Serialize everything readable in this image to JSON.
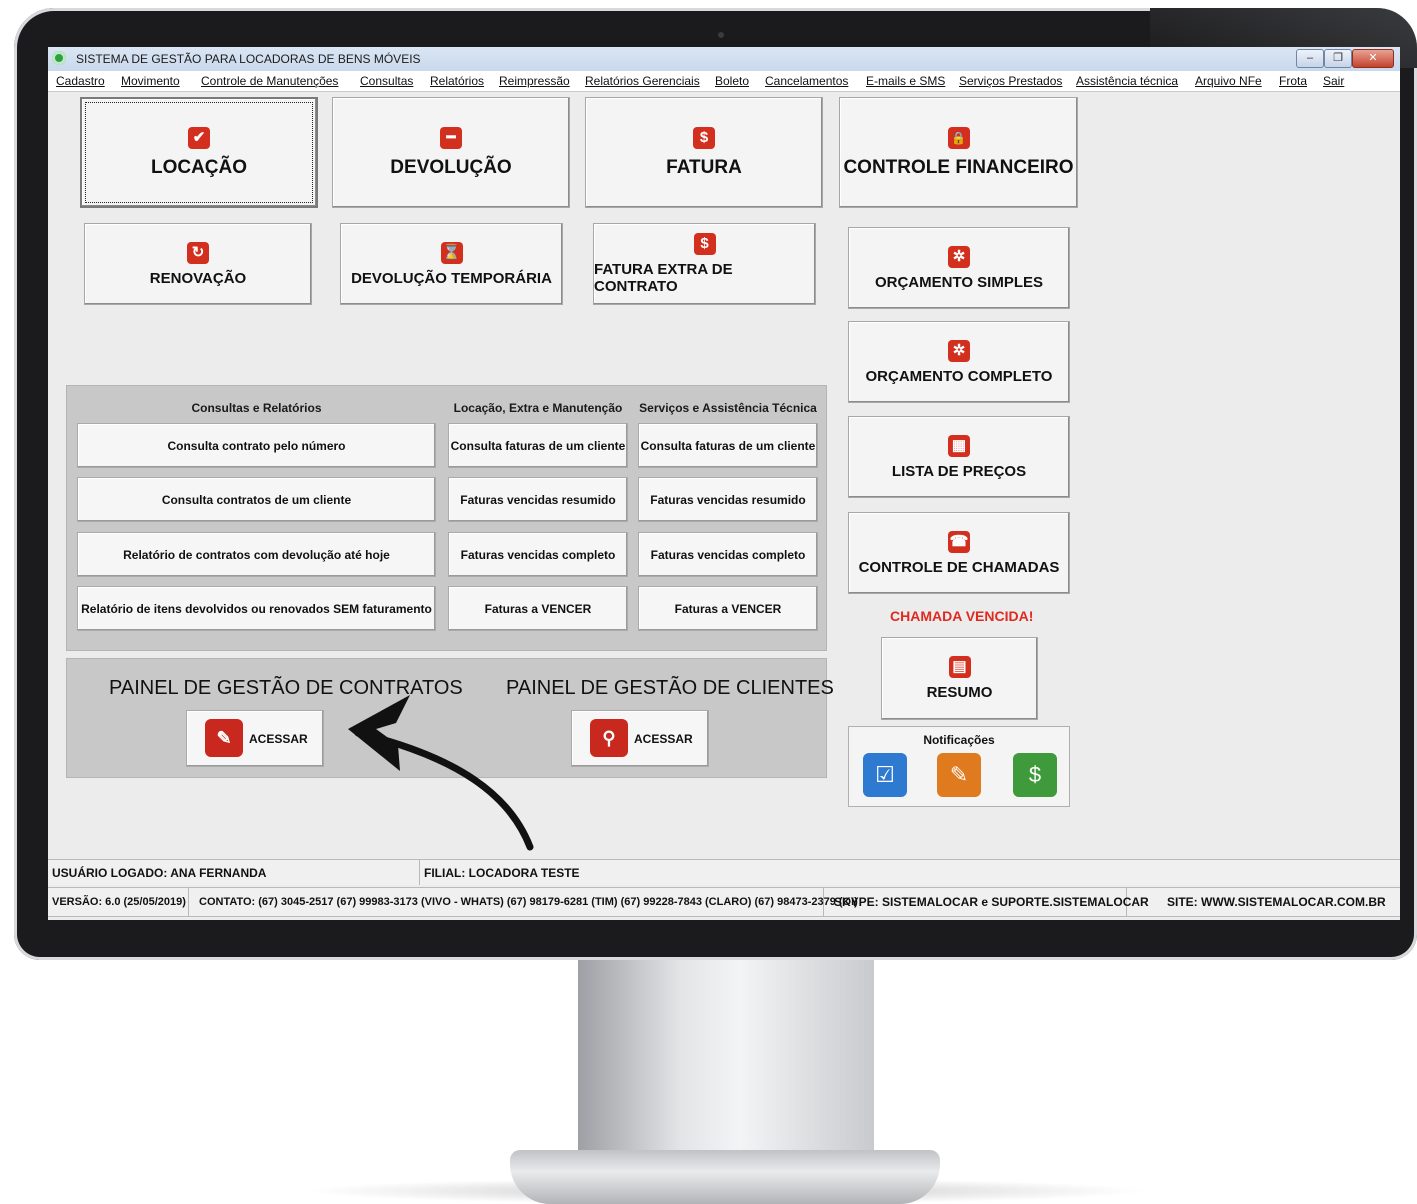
{
  "window": {
    "title": "SISTEMA DE GESTÃO PARA LOCADORAS DE BENS MÓVEIS",
    "minimize_glyph": "–",
    "restore_glyph": "❐",
    "close_glyph": "✕"
  },
  "menu": [
    "Cadastro",
    "Movimento",
    "Controle de Manutenções",
    "Consultas",
    "Relatórios",
    "Reimpressão",
    "Relatórios Gerenciais",
    "Boleto",
    "Cancelamentos",
    "E-mails e SMS",
    "Serviços Prestados",
    "Assistência técnica",
    "Arquivo NFe",
    "Frota",
    "Sair"
  ],
  "main_buttons": {
    "locacao": {
      "label": "LOCAÇÃO",
      "icon": "check-icon",
      "glyph": "✔"
    },
    "devolucao": {
      "label": "DEVOLUÇÃO",
      "icon": "minus-icon",
      "glyph": "━"
    },
    "fatura": {
      "label": "FATURA",
      "icon": "dollar-icon",
      "glyph": "$"
    },
    "controle_financeiro": {
      "label": "CONTROLE FINANCEIRO",
      "icon": "lock-icon",
      "glyph": "🔒"
    },
    "renovacao": {
      "label": "RENOVAÇÃO",
      "icon": "refresh-icon",
      "glyph": "↻"
    },
    "devolucao_temporaria": {
      "label": "DEVOLUÇÃO TEMPORÁRIA",
      "icon": "hourglass-icon",
      "glyph": "⌛"
    },
    "fatura_extra": {
      "label": "FATURA EXTRA DE CONTRATO",
      "icon": "dollar-icon",
      "glyph": "$"
    }
  },
  "side_buttons": {
    "orcamento_simples": {
      "label": "ORÇAMENTO SIMPLES",
      "icon": "gear-icon",
      "glyph": "✲"
    },
    "orcamento_completo": {
      "label": "ORÇAMENTO COMPLETO",
      "icon": "gear-icon",
      "glyph": "✲"
    },
    "lista_precos": {
      "label": "LISTA DE PREÇOS",
      "icon": "calculator-icon",
      "glyph": "▦"
    },
    "controle_chamadas": {
      "label": "CONTROLE DE CHAMADAS",
      "icon": "phone-icon",
      "glyph": "☎"
    },
    "alert": "CHAMADA VENCIDA!",
    "resumo": {
      "label": "RESUMO",
      "icon": "document-icon",
      "glyph": "▤"
    }
  },
  "queries": {
    "col1": {
      "header": "Consultas e Relatórios",
      "items": [
        "Consulta contrato pelo número",
        "Consulta contratos de um cliente",
        "Relatório de contratos com devolução até hoje",
        "Relatório de itens devolvidos ou renovados SEM faturamento"
      ]
    },
    "col2": {
      "header": "Locação, Extra e Manutenção",
      "items": [
        "Consulta faturas de um cliente",
        "Faturas vencidas resumido",
        "Faturas vencidas completo",
        "Faturas a VENCER"
      ]
    },
    "col3": {
      "header": "Serviços e Assistência Técnica",
      "items": [
        "Consulta faturas de um cliente",
        "Faturas vencidas resumido",
        "Faturas vencidas completo",
        "Faturas a VENCER"
      ]
    }
  },
  "panels": {
    "contratos": {
      "title": "PAINEL DE GESTÃO DE CONTRATOS",
      "button": "ACESSAR",
      "icon": "contract-icon",
      "glyph": "✎"
    },
    "clientes": {
      "title": "PAINEL DE GESTÃO DE CLIENTES",
      "button": "ACESSAR",
      "icon": "clients-search-icon",
      "glyph": "⚲"
    }
  },
  "notifications": {
    "title": "Notificações",
    "icons": [
      {
        "name": "checklist-notification-icon",
        "color": "#2f7ad1",
        "glyph": "☑"
      },
      {
        "name": "invoice-edit-notification-icon",
        "color": "#e07a1f",
        "glyph": "✎"
      },
      {
        "name": "payment-notification-icon",
        "color": "#3e9a3a",
        "glyph": "$"
      }
    ]
  },
  "status": {
    "usuario": "USUÁRIO LOGADO: ANA FERNANDA",
    "filial": "FILIAL: LOCADORA TESTE",
    "versao": "VERSÃO: 6.0 (25/05/2019)",
    "contato": "CONTATO: (67) 3045-2517 (67) 99983-3173 (VIVO - WHATS)  (67) 98179-6281 (TIM) (67) 99228-7843 (CLARO) (67) 98473-2379 (OI)",
    "skype": "SKYPE: SISTEMALOCAR e SUPORTE.SISTEMALOCAR",
    "site": "SITE: WWW.SISTEMALOCAR.COM.BR"
  },
  "colors": {
    "accent_red": "#d32f1f",
    "alert_red": "#e02a1f",
    "panel_gray": "#c8c8c8"
  }
}
